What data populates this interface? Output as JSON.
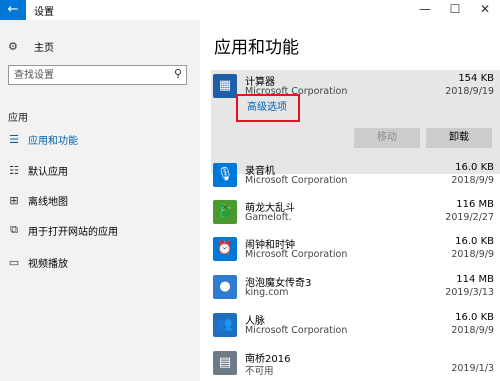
{
  "window": {
    "title": "设置",
    "back_glyph": "←",
    "min_glyph": "—",
    "max_glyph": "☐",
    "close_glyph": "✕"
  },
  "sidebar": {
    "home": {
      "label": "主页",
      "icon": "gear-icon",
      "glyph": "⚙"
    },
    "search": {
      "placeholder": "查找设置",
      "icon": "search-icon",
      "glyph": "⚲"
    },
    "section": "应用",
    "items": [
      {
        "label": "应用和功能",
        "icon": "apps-list-icon",
        "glyph": "☰",
        "active": true
      },
      {
        "label": "默认应用",
        "icon": "default-apps-icon",
        "glyph": "☷",
        "active": false
      },
      {
        "label": "离线地图",
        "icon": "map-icon",
        "glyph": "⊞",
        "active": false
      },
      {
        "label": "用于打开网站的应用",
        "icon": "web-apps-icon",
        "glyph": "⧉",
        "active": false
      },
      {
        "label": "视频播放",
        "icon": "video-icon",
        "glyph": "▭",
        "active": false
      }
    ]
  },
  "main": {
    "title": "应用和功能",
    "selected_app": {
      "name": "计算器",
      "publisher": "Microsoft Corporation",
      "size": "154 KB",
      "date": "2018/9/19",
      "icon": "calculator-icon",
      "glyph": "▦",
      "advanced_link": "高级选项",
      "move_label": "移动",
      "uninstall_label": "卸载"
    },
    "apps": [
      {
        "name": "录音机",
        "publisher": "Microsoft Corporation",
        "size": "16.0 KB",
        "date": "2018/9/9",
        "icon": "microphone-icon",
        "glyph": "🎙"
      },
      {
        "name": "萌龙大乱斗",
        "publisher": "Gameloft.",
        "size": "116 MB",
        "date": "2019/2/27",
        "icon": "dragon-game-icon",
        "glyph": "🐉"
      },
      {
        "name": "闹钟和时钟",
        "publisher": "Microsoft Corporation",
        "size": "16.0 KB",
        "date": "2018/9/9",
        "icon": "alarm-clock-icon",
        "glyph": "⏰"
      },
      {
        "name": "泡泡魔女传奇3",
        "publisher": "king.com",
        "size": "114 MB",
        "date": "2019/3/13",
        "icon": "bubble-game-icon",
        "glyph": "●"
      },
      {
        "name": "人脉",
        "publisher": "Microsoft Corporation",
        "size": "16.0 KB",
        "date": "2018/9/9",
        "icon": "people-icon",
        "glyph": "👥"
      },
      {
        "name": "南桥2016",
        "publisher": "不可用",
        "size": "",
        "date": "2019/1/3",
        "icon": "nanqiao-icon",
        "glyph": "▤"
      }
    ]
  }
}
